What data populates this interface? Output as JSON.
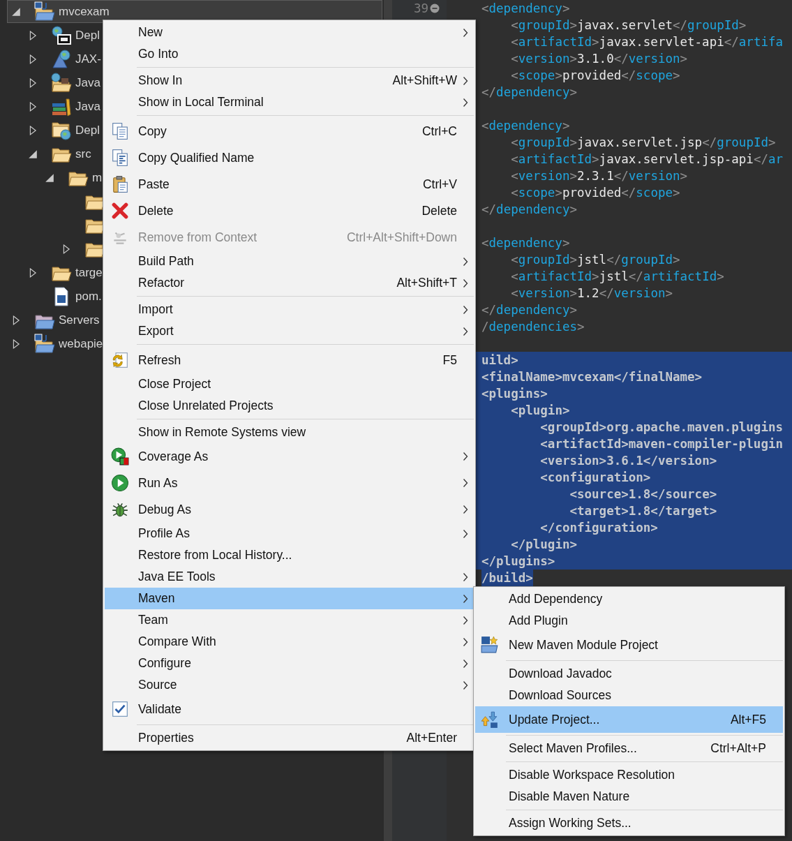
{
  "project_tree": [
    {
      "label": "mvcexam",
      "kind": "maven-project",
      "expanded": true,
      "selected": true,
      "children": [
        {
          "label": "Depl",
          "kind": "deploy",
          "expanded": false,
          "selected": false
        },
        {
          "label": "JAX-",
          "kind": "webservice",
          "expanded": false,
          "selected": false
        },
        {
          "label": "Java",
          "kind": "java-resources",
          "expanded": false,
          "selected": false
        },
        {
          "label": "Java",
          "kind": "javascript",
          "expanded": false,
          "selected": false
        },
        {
          "label": "Depl",
          "kind": "deploy-folder",
          "expanded": false,
          "selected": false
        },
        {
          "label": "src",
          "kind": "folder",
          "expanded": true,
          "selected": false,
          "children": [
            {
              "label": "m",
              "kind": "folder",
              "expanded": true,
              "selected": false,
              "children": [
                {
                  "kind": "folder",
                  "selected": false
                },
                {
                  "kind": "folder",
                  "selected": false
                },
                {
                  "kind": "folder",
                  "expanded": false,
                  "selected": false
                }
              ]
            }
          ]
        },
        {
          "label": "targe",
          "kind": "folder",
          "expanded": false,
          "selected": false
        },
        {
          "label": "pom.",
          "kind": "pom-file",
          "selected": false
        }
      ]
    },
    {
      "label": "Servers",
      "kind": "servers-folder",
      "expanded": false,
      "selected": false
    },
    {
      "label": "webapie",
      "kind": "maven-project",
      "expanded": false,
      "selected": false
    }
  ],
  "editor": {
    "line_numbers": [
      "39"
    ],
    "blocks": [
      {
        "lines": [
          {
            "text": "<dependency>",
            "selected": false
          },
          {
            "text": "    <groupId>javax.servlet</groupId>",
            "selected": false
          },
          {
            "text": "    <artifactId>javax.servlet-api</artifa",
            "selected": false
          },
          {
            "text": "    <version>3.1.0</version>",
            "selected": false
          },
          {
            "text": "    <scope>provided</scope>",
            "selected": false
          },
          {
            "text": "</dependency>",
            "selected": false
          }
        ]
      },
      {
        "lines": [
          {
            "text": "<dependency>",
            "selected": false
          },
          {
            "text": "    <groupId>javax.servlet.jsp</groupId>",
            "selected": false
          },
          {
            "text": "    <artifactId>javax.servlet.jsp-api</ar",
            "selected": false
          },
          {
            "text": "    <version>2.3.1</version>",
            "selected": false
          },
          {
            "text": "    <scope>provided</scope>",
            "selected": false
          },
          {
            "text": "</dependency>",
            "selected": false
          }
        ]
      },
      {
        "lines": [
          {
            "text": "<dependency>",
            "selected": false
          },
          {
            "text": "    <groupId>jstl</groupId>",
            "selected": false
          },
          {
            "text": "    <artifactId>jstl</artifactId>",
            "selected": false
          },
          {
            "text": "    <version>1.2</version>",
            "selected": false
          },
          {
            "text": "</dependency>",
            "selected": false
          },
          {
            "text": "/dependencies>",
            "selected": false
          }
        ]
      },
      {
        "lines": [
          {
            "text": "uild>",
            "selected": true
          },
          {
            "text": "<finalName>mvcexam</finalName>",
            "selected": true
          },
          {
            "text": "<plugins>",
            "selected": true
          },
          {
            "text": "    <plugin>",
            "selected": true
          },
          {
            "text": "        <groupId>org.apache.maven.plugins",
            "selected": true
          },
          {
            "text": "        <artifactId>maven-compiler-plugin",
            "selected": true
          },
          {
            "text": "        <version>3.6.1</version>",
            "selected": true
          },
          {
            "text": "        <configuration>",
            "selected": true
          },
          {
            "text": "            <source>1.8</source>",
            "selected": true
          },
          {
            "text": "            <target>1.8</target>",
            "selected": true
          },
          {
            "text": "        </configuration>",
            "selected": true
          },
          {
            "text": "    </plugin>",
            "selected": true
          },
          {
            "text": "</plugins>",
            "selected": true
          },
          {
            "text": "/build>",
            "selected": true
          }
        ]
      }
    ]
  },
  "context_menu": {
    "items": [
      {
        "kind": "item",
        "label": "New",
        "submenu": true,
        "disabled": false,
        "selected": false
      },
      {
        "kind": "item",
        "label": "Go Into",
        "submenu": false,
        "disabled": false,
        "selected": false
      },
      {
        "kind": "separator"
      },
      {
        "kind": "item",
        "label": "Show In",
        "shortcut": "Alt+Shift+W",
        "submenu": true,
        "disabled": false,
        "selected": false
      },
      {
        "kind": "item",
        "label": "Show in Local Terminal",
        "submenu": true,
        "disabled": false,
        "selected": false
      },
      {
        "kind": "separator"
      },
      {
        "kind": "copy",
        "label": "Copy",
        "shortcut": "Ctrl+C",
        "submenu": false,
        "disabled": false,
        "selected": false
      },
      {
        "kind": "copy-qualified",
        "label": "Copy Qualified Name",
        "submenu": false,
        "disabled": false,
        "selected": false
      },
      {
        "kind": "paste",
        "label": "Paste",
        "shortcut": "Ctrl+V",
        "submenu": false,
        "disabled": false,
        "selected": false
      },
      {
        "kind": "delete",
        "label": "Delete",
        "shortcut": "Delete",
        "submenu": false,
        "disabled": false,
        "selected": false
      },
      {
        "kind": "remove-context",
        "label": "Remove from Context",
        "shortcut": "Ctrl+Alt+Shift+Down",
        "submenu": false,
        "disabled": true,
        "selected": false
      },
      {
        "kind": "item",
        "label": "Build Path",
        "submenu": true,
        "disabled": false,
        "selected": false
      },
      {
        "kind": "item",
        "label": "Refactor",
        "shortcut": "Alt+Shift+T",
        "submenu": true,
        "disabled": false,
        "selected": false
      },
      {
        "kind": "separator"
      },
      {
        "kind": "item",
        "label": "Import",
        "submenu": true,
        "disabled": false,
        "selected": false
      },
      {
        "kind": "item",
        "label": "Export",
        "submenu": true,
        "disabled": false,
        "selected": false
      },
      {
        "kind": "separator"
      },
      {
        "kind": "refresh",
        "label": "Refresh",
        "shortcut": "F5",
        "submenu": false,
        "disabled": false,
        "selected": false
      },
      {
        "kind": "item",
        "label": "Close Project",
        "submenu": false,
        "disabled": false,
        "selected": false
      },
      {
        "kind": "item",
        "label": "Close Unrelated Projects",
        "submenu": false,
        "disabled": false,
        "selected": false
      },
      {
        "kind": "separator"
      },
      {
        "kind": "item",
        "label": "Show in Remote Systems view",
        "submenu": false,
        "disabled": false,
        "selected": false
      },
      {
        "kind": "coverage",
        "label": "Coverage As",
        "submenu": true,
        "disabled": false,
        "selected": false
      },
      {
        "kind": "run",
        "label": "Run As",
        "submenu": true,
        "disabled": false,
        "selected": false
      },
      {
        "kind": "debug",
        "label": "Debug As",
        "submenu": true,
        "disabled": false,
        "selected": false
      },
      {
        "kind": "item",
        "label": "Profile As",
        "submenu": true,
        "disabled": false,
        "selected": false
      },
      {
        "kind": "item",
        "label": "Restore from Local History...",
        "submenu": false,
        "disabled": false,
        "selected": false
      },
      {
        "kind": "item",
        "label": "Java EE Tools",
        "submenu": true,
        "disabled": false,
        "selected": false
      },
      {
        "kind": "item",
        "label": "Maven",
        "submenu": true,
        "disabled": false,
        "selected": true
      },
      {
        "kind": "item",
        "label": "Team",
        "submenu": true,
        "disabled": false,
        "selected": false
      },
      {
        "kind": "item",
        "label": "Compare With",
        "submenu": true,
        "disabled": false,
        "selected": false
      },
      {
        "kind": "item",
        "label": "Configure",
        "submenu": true,
        "disabled": false,
        "selected": false
      },
      {
        "kind": "item",
        "label": "Source",
        "submenu": true,
        "disabled": false,
        "selected": false
      },
      {
        "kind": "validate",
        "label": "Validate",
        "submenu": false,
        "disabled": false,
        "selected": false
      },
      {
        "kind": "separator"
      },
      {
        "kind": "item",
        "label": "Properties",
        "shortcut": "Alt+Enter",
        "submenu": false,
        "disabled": false,
        "selected": false
      }
    ]
  },
  "maven_submenu": {
    "items": [
      {
        "kind": "item",
        "label": "Add Dependency",
        "submenu": false,
        "disabled": false,
        "selected": false
      },
      {
        "kind": "item",
        "label": "Add Plugin",
        "submenu": false,
        "disabled": false,
        "selected": false
      },
      {
        "kind": "new-maven-module",
        "label": "New Maven Module Project",
        "submenu": false,
        "disabled": false,
        "selected": false
      },
      {
        "kind": "separator"
      },
      {
        "kind": "item",
        "label": "Download Javadoc",
        "submenu": false,
        "disabled": false,
        "selected": false
      },
      {
        "kind": "item",
        "label": "Download Sources",
        "submenu": false,
        "disabled": false,
        "selected": false
      },
      {
        "kind": "update-project",
        "label": "Update Project...",
        "shortcut": "Alt+F5",
        "submenu": false,
        "disabled": false,
        "selected": true
      },
      {
        "kind": "separator"
      },
      {
        "kind": "item",
        "label": "Select Maven Profiles...",
        "shortcut": "Ctrl+Alt+P",
        "submenu": false,
        "disabled": false,
        "selected": false
      },
      {
        "kind": "separator"
      },
      {
        "kind": "item",
        "label": "Disable Workspace Resolution",
        "submenu": false,
        "disabled": false,
        "selected": false
      },
      {
        "kind": "item",
        "label": "Disable Maven Nature",
        "submenu": false,
        "disabled": false,
        "selected": false
      },
      {
        "kind": "separator"
      },
      {
        "kind": "item",
        "label": "Assign Working Sets...",
        "submenu": false,
        "disabled": false,
        "selected": false
      }
    ]
  }
}
